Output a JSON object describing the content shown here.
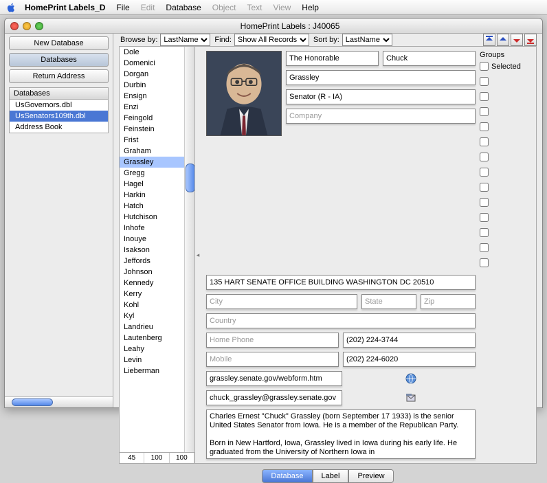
{
  "menubar": {
    "app_name": "HomePrint Labels_D",
    "items": [
      "File",
      "Edit",
      "Database",
      "Object",
      "Text",
      "View",
      "Help"
    ],
    "disabled": [
      "Edit",
      "Object",
      "Text",
      "View"
    ]
  },
  "window": {
    "title": "HomePrint Labels : J40065"
  },
  "sidebar": {
    "new_db": "New Database",
    "databases_btn": "Databases",
    "return_addr": "Return Address",
    "databases_head": "Databases",
    "items": [
      "UsGovernors.dbl",
      "UsSenators109th.dbl",
      "Address Book"
    ],
    "selected": "UsSenators109th.dbl"
  },
  "toolbar": {
    "browse_lbl": "Browse by:",
    "browse_val": "LastName",
    "find_lbl": "Find:",
    "find_val": "Show All Records",
    "sort_lbl": "Sort by:",
    "sort_val": "LastName"
  },
  "namelist": {
    "items": [
      "Dole",
      "Domenici",
      "Dorgan",
      "Durbin",
      "Ensign",
      "Enzi",
      "Feingold",
      "Feinstein",
      "Frist",
      "Graham",
      "Grassley",
      "Gregg",
      "Hagel",
      "Harkin",
      "Hatch",
      "Hutchison",
      "Inhofe",
      "Inouye",
      "Isakson",
      "Jeffords",
      "Johnson",
      "Kennedy",
      "Kerry",
      "Kohl",
      "Kyl",
      "Landrieu",
      "Lautenberg",
      "Leahy",
      "Levin",
      "Lieberman"
    ],
    "selected": "Grassley",
    "footer": [
      "45",
      "100",
      "100"
    ]
  },
  "record": {
    "prefix": "The Honorable",
    "first": "Chuck",
    "last": "Grassley",
    "title": "Senator (R - IA)",
    "company_ph": "Company",
    "address": "135 HART SENATE OFFICE BUILDING WASHINGTON DC 20510",
    "city_ph": "City",
    "state_ph": "State",
    "zip_ph": "Zip",
    "country_ph": "Country",
    "homephone_ph": "Home Phone",
    "homephone2": "(202) 224-3744",
    "mobile_ph": "Mobile",
    "mobile2": "(202) 224-6020",
    "web": "grassley.senate.gov/webform.htm",
    "email": "chuck_grassley@grassley.senate.gov",
    "notes": "Charles Ernest \"Chuck\" Grassley (born September 17 1933) is the senior United States Senator from Iowa. He is a member of the Republican Party.\n\nBorn in New Hartford, Iowa, Grassley lived in Iowa during his early life. He graduated from the University of Northern Iowa in"
  },
  "groups": {
    "title": "Groups",
    "selected_lbl": "Selected"
  },
  "tabs": {
    "database": "Database",
    "label": "Label",
    "preview": "Preview"
  }
}
